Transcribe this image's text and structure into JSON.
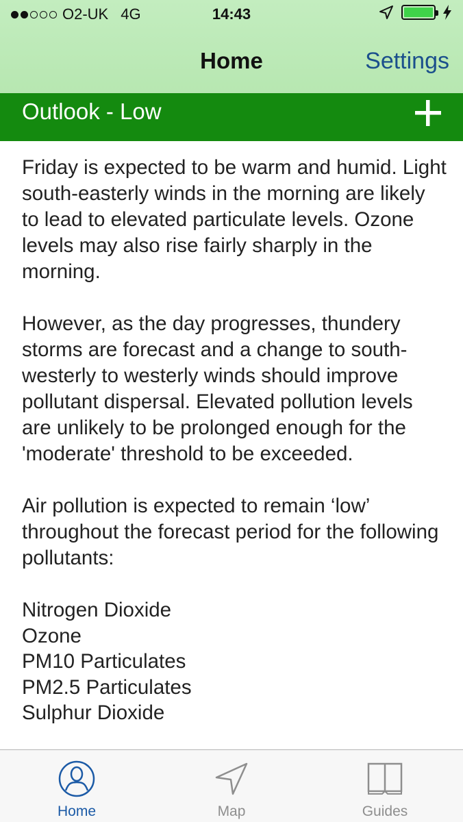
{
  "status_bar": {
    "carrier": "O2-UK",
    "network": "4G",
    "time": "14:43",
    "battery_level": 1.0
  },
  "nav": {
    "title": "Home",
    "settings_label": "Settings"
  },
  "outlook": {
    "label": "Outlook - Low"
  },
  "forecast": {
    "paragraphs": [
      "Friday is expected to be warm and humid. Light south-easterly winds in the morning are likely to lead to elevated particulate levels. Ozone levels may also rise fairly sharply in the morning.",
      "However, as the day progresses, thundery storms are forecast and a change to south-westerly to westerly winds should improve pollutant dispersal. Elevated pollution levels are unlikely to be prolonged enough for the 'moderate' threshold to be exceeded.",
      "Air pollution is expected to remain ‘low’ throughout the forecast period for the following pollutants:"
    ],
    "pollutants": [
      "Nitrogen Dioxide",
      "Ozone",
      "PM10 Particulates",
      "PM2.5 Particulates",
      "Sulphur Dioxide"
    ]
  },
  "tabs": {
    "home": "Home",
    "map": "Map",
    "guides": "Guides"
  },
  "colors": {
    "header_bg": "#bfeab9",
    "outlook_bg": "#148a0f",
    "accent": "#1b5aa6",
    "battery": "#3fd34a"
  },
  "icons": {
    "location": "location-arrow-icon",
    "charging": "lightning-bolt-icon",
    "expand": "plus-icon",
    "home_tab": "person-icon",
    "map_tab": "navigation-arrow-icon",
    "guides_tab": "book-icon"
  }
}
